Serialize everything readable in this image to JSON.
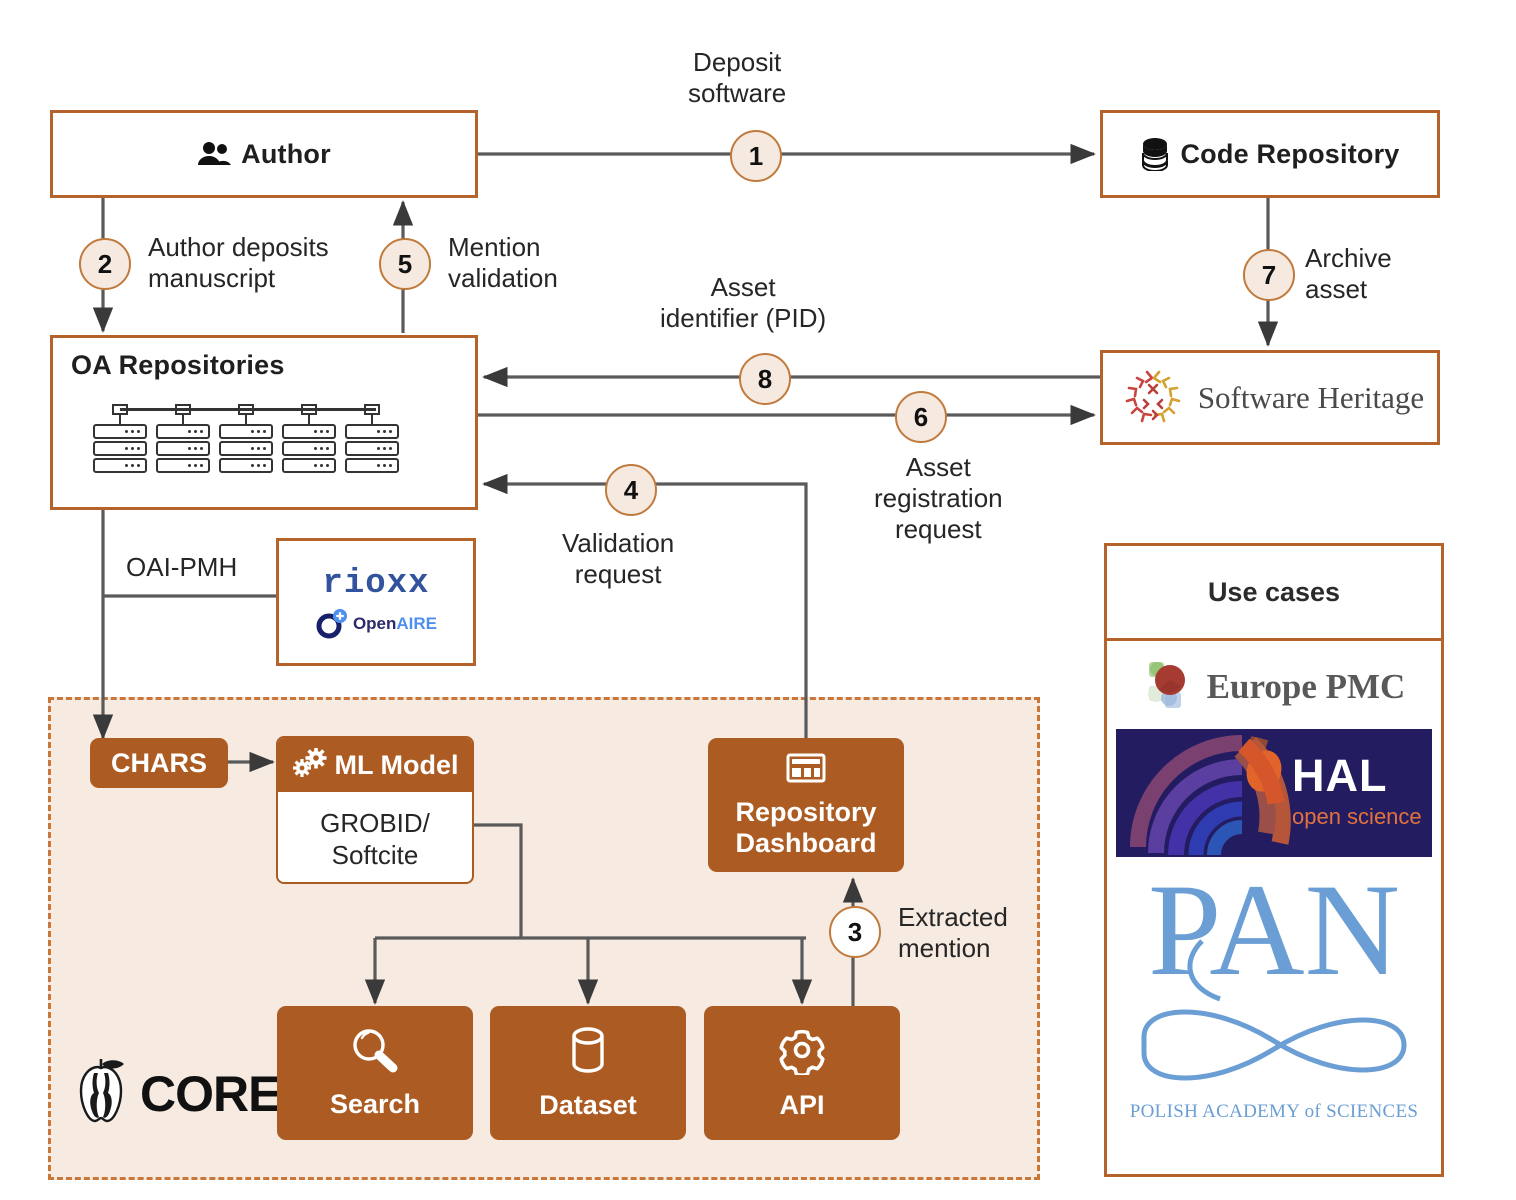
{
  "diagram": {
    "title_absent": true,
    "nodes": {
      "author": {
        "label": "Author",
        "icon": "people-icon"
      },
      "code_repository": {
        "label": "Code Repository",
        "icon": "database-icon"
      },
      "oa_repositories": {
        "label": "OA Repositories",
        "icon": "server-rack-icon"
      },
      "software_heritage": {
        "label": "Software Heritage",
        "icon": "software-heritage-logo"
      },
      "rioxx": {
        "label": "rioxx",
        "sublabel": "OpenAIRE"
      },
      "chars": {
        "label": "CHARS"
      },
      "ml_model": {
        "label": "ML Model",
        "body": "GROBID/\nSoftcite",
        "icon": "gears-icon"
      },
      "repository_dashboard": {
        "label": "Repository\nDashboard",
        "icon": "dashboard-icon"
      },
      "core": {
        "label": "CORE",
        "icon": "apple-core-icon"
      },
      "search": {
        "label": "Search",
        "icon": "magnifier-icon"
      },
      "dataset": {
        "label": "Dataset",
        "icon": "cylinder-icon"
      },
      "api": {
        "label": "API",
        "icon": "gear-icon"
      }
    },
    "edges": [
      {
        "num": "1",
        "label": "Deposit\nsoftware",
        "from": "author",
        "to": "code_repository"
      },
      {
        "num": "2",
        "label": "Author deposits\nmanuscript",
        "from": "author",
        "to": "oa_repositories"
      },
      {
        "num": "3",
        "label": "Extracted\nmention",
        "from": "api",
        "to": "repository_dashboard"
      },
      {
        "num": "4",
        "label": "Validation\nrequest",
        "from": "repository_dashboard",
        "to": "oa_repositories"
      },
      {
        "num": "5",
        "label": "Mention\nvalidation",
        "from": "oa_repositories",
        "to": "author"
      },
      {
        "num": "6",
        "label": "Asset\nregistration\nrequest",
        "from": "oa_repositories",
        "to": "software_heritage"
      },
      {
        "num": "7",
        "label": "Archive\nasset",
        "from": "code_repository",
        "to": "software_heritage"
      },
      {
        "num": "8",
        "label": "Asset\nidentifier (PID)",
        "from": "software_heritage",
        "to": "oa_repositories"
      }
    ],
    "plain_edge_labels": [
      {
        "label": "OAI-PMH"
      }
    ],
    "use_cases": {
      "heading": "Use cases",
      "items": [
        {
          "name": "Europe PMC",
          "logo": "europe-pmc-logo"
        },
        {
          "name": "HAL",
          "tagline": "open science",
          "logo": "hal-logo"
        },
        {
          "name": "PAN",
          "caption": "POLISH ACADEMY of SCIENCES",
          "logo": "pan-logo"
        }
      ]
    },
    "colors": {
      "brand_brown": "#ac5c22",
      "border_brown": "#b4632a",
      "region_fill": "#f6eae1",
      "badge_fill": "#f6eae0",
      "badge_border": "#c07a3e",
      "connector": "#5a5a5a"
    }
  }
}
